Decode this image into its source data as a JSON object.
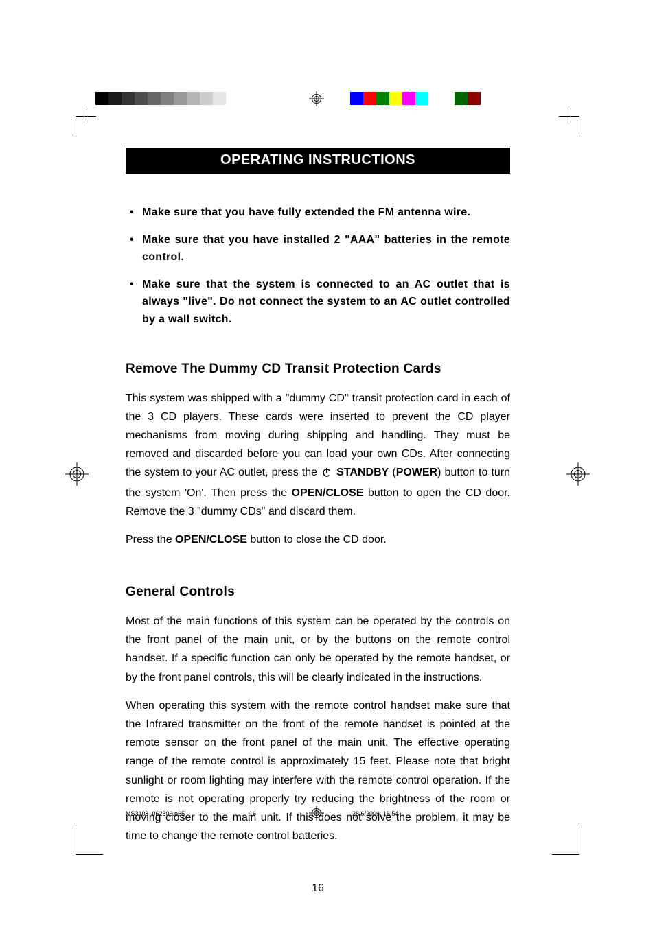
{
  "banner_title": "OPERATING INSTRUCTIONS",
  "bullets": [
    "Make sure that you have fully extended the FM antenna wire.",
    "Make sure that you have installed 2 \"AAA\" batteries in the remote control.",
    "Make sure that the system is connected to an AC outlet that is always \"live\". Do not connect the system to an AC outlet controlled by a wall switch."
  ],
  "section1": {
    "heading": "Remove The Dummy CD Transit Protection Cards",
    "p1_a": "This system was shipped with a \"dummy CD\" transit protection card in each of the 3 CD players. These cards were inserted to prevent the CD player mechanisms from moving during shipping and handling. They must be removed and discarded before you can load your own CDs. After connecting the system to your AC outlet, press the ",
    "p1_b": " STANDBY",
    "p1_c": " (",
    "p1_d": "POWER",
    "p1_e": ") button to turn the system 'On'. Then press the ",
    "p1_f": "OPEN/CLOSE",
    "p1_g": " button to open the CD door. Remove the 3 \"dummy CDs\" and discard them.",
    "p2_a": "Press the ",
    "p2_b": "OPEN/CLOSE",
    "p2_c": " button to close the CD door."
  },
  "section2": {
    "heading": "General Controls",
    "p1": "Most of the main functions of this system can be operated by the controls on the front panel of the main unit, or by the buttons on the remote control handset. If a specific function can only be operated by the remote handset, or by the front panel controls, this will be clearly indicated in the instructions.",
    "p2": "When operating this system with the remote control handset make sure that the Infrared transmitter on the front of the remote handset is pointed at the remote sensor on the front panel of the main unit. The effective operating range of the remote control is approximately 15 feet. Please note that bright sunlight or room lighting may interfere with the remote control operation. If the remote is not operating properly try reducing the brightness of the room or moving closer to the main unit. If this does not solve the problem, it may be time to change the remote control batteries."
  },
  "page_number": "16",
  "footer": {
    "file": "MS3108_062806.p65",
    "pg": "16",
    "ts": "28/6/2006, 16:54"
  },
  "grey_swatches": [
    "#000000",
    "#1a1a1a",
    "#333333",
    "#4d4d4d",
    "#666666",
    "#808080",
    "#999999",
    "#b3b3b3",
    "#cccccc",
    "#e6e6e6"
  ],
  "color_swatches": [
    "#0000ff",
    "#ff0000",
    "#008000",
    "#ffff00",
    "#ff00ff",
    "#00ffff",
    "#ffffff",
    "#ffffff",
    "#006400",
    "#8b0000"
  ]
}
